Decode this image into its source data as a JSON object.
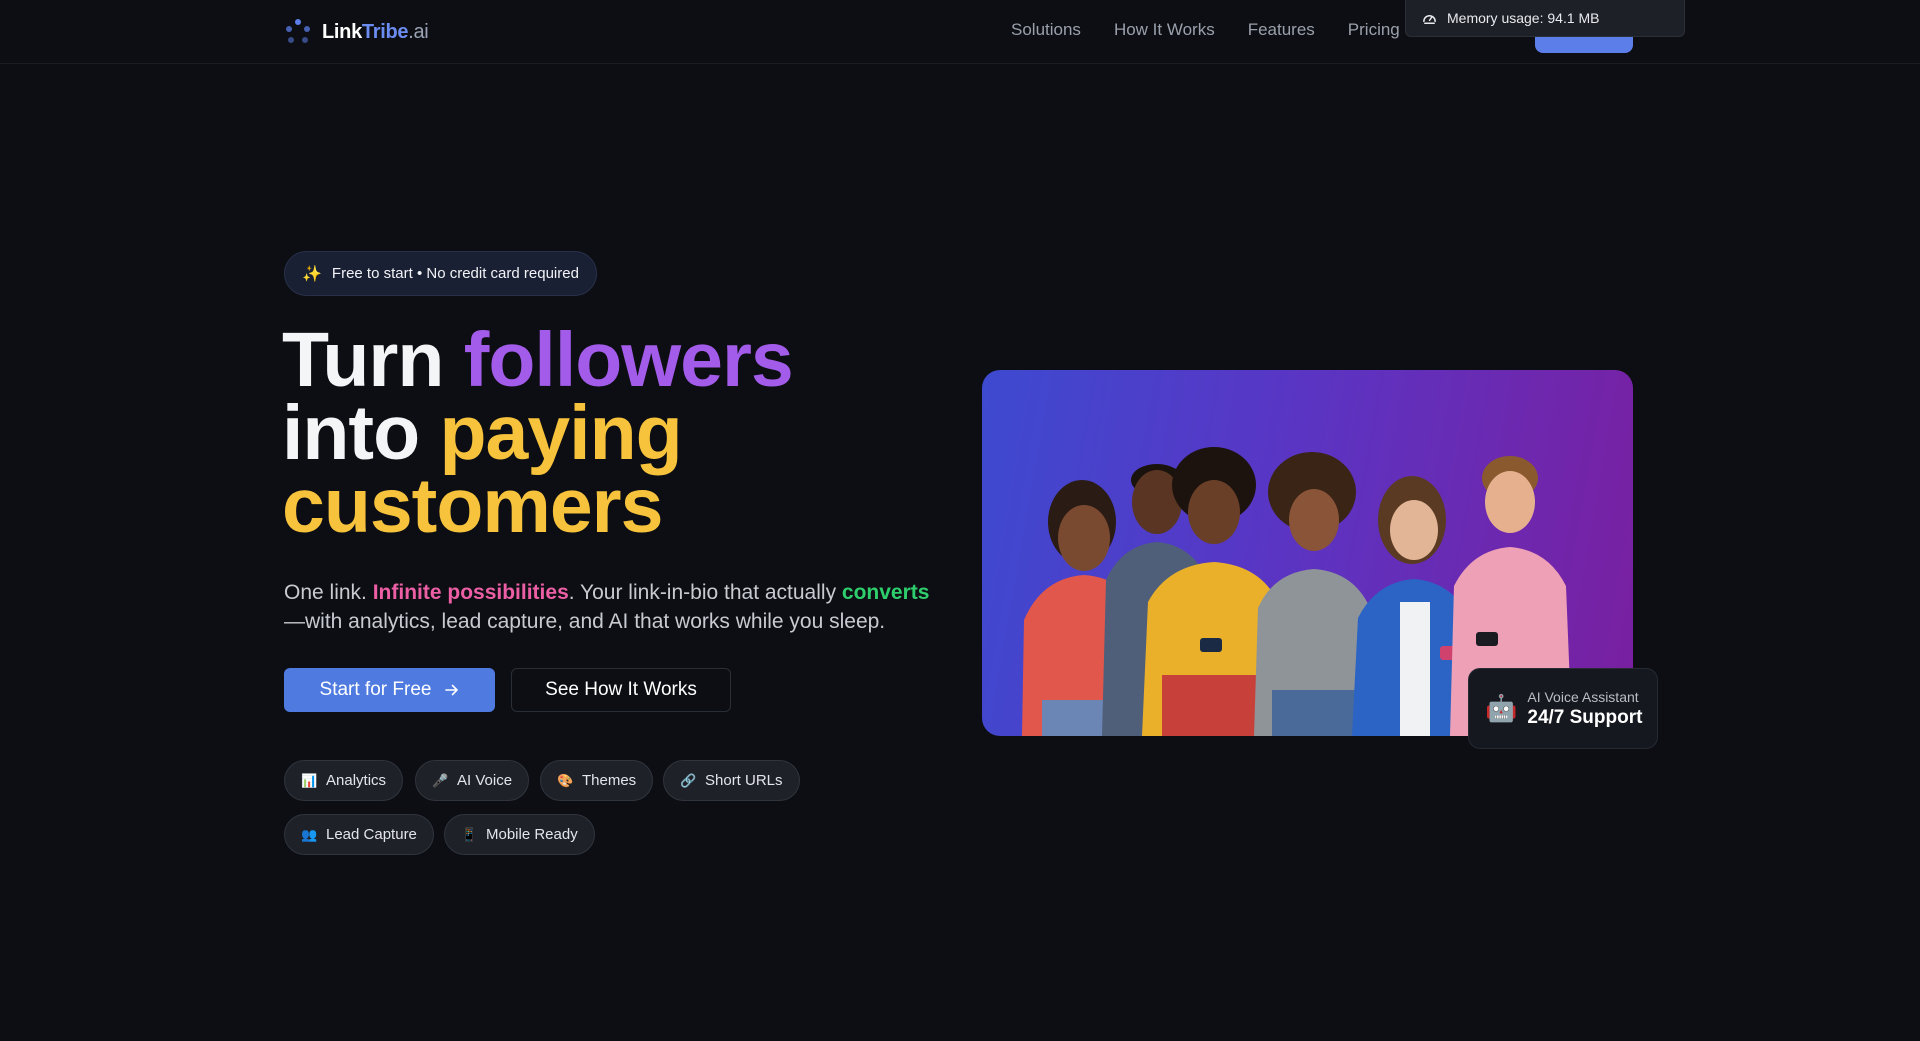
{
  "header": {
    "logo": {
      "part1": "Link",
      "part2": "Tribe",
      "part3": ".ai"
    },
    "nav": [
      "Solutions",
      "How It Works",
      "Features",
      "Pricing"
    ],
    "memory": "Memory usage: 94.1 MB"
  },
  "hero": {
    "badge": "Free to start • No credit card required",
    "headline": {
      "w1": "Turn ",
      "w2": "followers",
      "w3": "into ",
      "w4": "paying",
      "w5": "customers"
    },
    "subtitle": {
      "s1": "One link. ",
      "s2": "Infinite possibilities",
      "s3": ". Your link-in-bio that actually ",
      "s4": "converts",
      "s5": "—with analytics, lead capture, and AI that works while you sleep."
    },
    "primary_button": "Start for Free",
    "secondary_button": "See How It Works",
    "features": [
      {
        "icon": "bar-chart-icon",
        "label": "Analytics"
      },
      {
        "icon": "microphone-icon",
        "label": "AI Voice"
      },
      {
        "icon": "palette-icon",
        "label": "Themes"
      },
      {
        "icon": "link-icon",
        "label": "Short URLs"
      },
      {
        "icon": "users-icon",
        "label": "Lead Capture"
      },
      {
        "icon": "mobile-icon",
        "label": "Mobile Ready"
      }
    ]
  },
  "voice_card": {
    "label": "AI Voice Assistant",
    "value": "24/7 Support"
  },
  "colors": {
    "accent": "#4f7be0",
    "purple": "#a35bea",
    "yellow": "#f7c23c",
    "pink": "#ec5fa5",
    "green": "#2fce6d"
  }
}
